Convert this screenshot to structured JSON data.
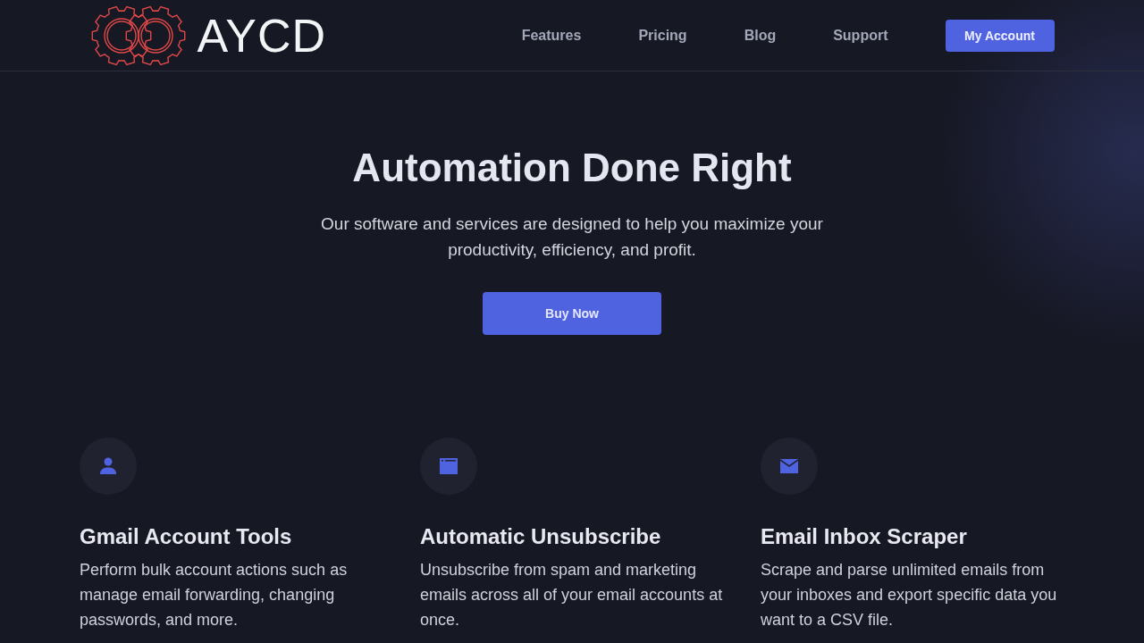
{
  "header": {
    "brand": "AYCD",
    "nav": [
      "Features",
      "Pricing",
      "Blog",
      "Support"
    ],
    "account_button": "My Account"
  },
  "hero": {
    "title": "Automation Done Right",
    "subtitle": "Our software and services are designed to help you maximize your productivity, efficiency, and profit.",
    "button": "Buy Now"
  },
  "features": [
    {
      "kind": "user",
      "title": "Gmail Account Tools",
      "description": "Perform bulk account actions such as manage email forwarding, changing passwords, and more."
    },
    {
      "kind": "window",
      "title": "Automatic Unsubscribe",
      "description": "Unsubscribe from spam and marketing emails across all of your email accounts at once."
    },
    {
      "kind": "mail",
      "title": "Email Inbox Scraper",
      "description": "Scrape and parse unlimited emails from your inboxes and export specific data you want to a CSV file."
    }
  ]
}
